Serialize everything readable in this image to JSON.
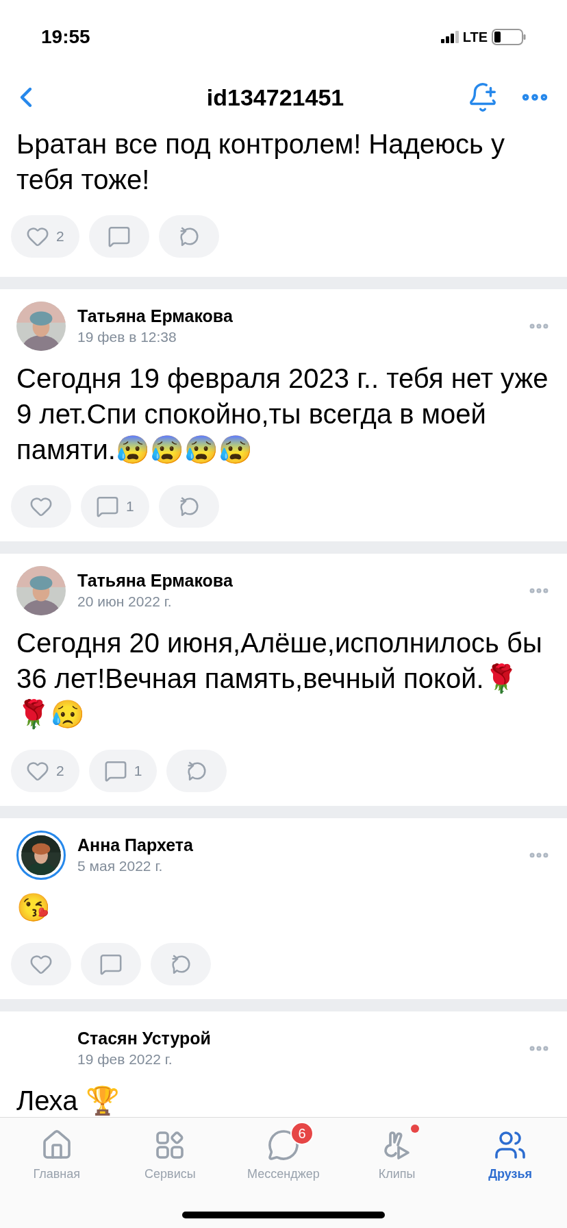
{
  "status_bar": {
    "time": "19:55",
    "network": "LTE"
  },
  "header": {
    "title": "id134721451"
  },
  "posts": [
    {
      "kind": "continued",
      "text": "Ьратан все под контролем! Надеюсь у тебя тоже!",
      "actions": [
        {
          "kind": "like",
          "count": "2"
        },
        {
          "kind": "comment"
        },
        {
          "kind": "share"
        }
      ]
    },
    {
      "kind": "post",
      "author": "Татьяна Ермакова",
      "date": "19 фев в 12:38",
      "avatar": true,
      "story": false,
      "text": "Сегодня 19 февраля 2023 г.. тебя нет уже 9 лет.Спи спокойно,ты всегда в моей памяти.😰😰😰😰",
      "actions": [
        {
          "kind": "like"
        },
        {
          "kind": "comment",
          "count": "1"
        },
        {
          "kind": "share"
        }
      ]
    },
    {
      "kind": "post",
      "author": "Татьяна Ермакова",
      "date": "20 июн 2022 г.",
      "avatar": true,
      "story": false,
      "text": "Сегодня 20 июня,Алёше,исполнилось бы 36 лет!Вечная память,вечный покой.🌹🌹😥",
      "actions": [
        {
          "kind": "like",
          "count": "2"
        },
        {
          "kind": "comment",
          "count": "1"
        },
        {
          "kind": "share"
        }
      ]
    },
    {
      "kind": "post",
      "author": "Анна Пархета",
      "date": "5 мая 2022 г.",
      "avatar": true,
      "story": true,
      "text": "😘",
      "actions": [
        {
          "kind": "like"
        },
        {
          "kind": "comment"
        },
        {
          "kind": "share"
        }
      ]
    },
    {
      "kind": "post",
      "author": "Стасян Устурой",
      "date": "19 фев 2022 г.",
      "avatar": false,
      "text": "Леха 🏆"
    }
  ],
  "tab_bar": [
    {
      "kind": "home",
      "label": "Главная",
      "selected": false
    },
    {
      "kind": "services",
      "label": "Сервисы",
      "selected": false
    },
    {
      "kind": "messenger",
      "label": "Мессенджер",
      "selected": false,
      "badge": "6"
    },
    {
      "kind": "clips",
      "label": "Клипы",
      "selected": false,
      "dot": true
    },
    {
      "kind": "friends",
      "label": "Друзья",
      "selected": true
    }
  ]
}
